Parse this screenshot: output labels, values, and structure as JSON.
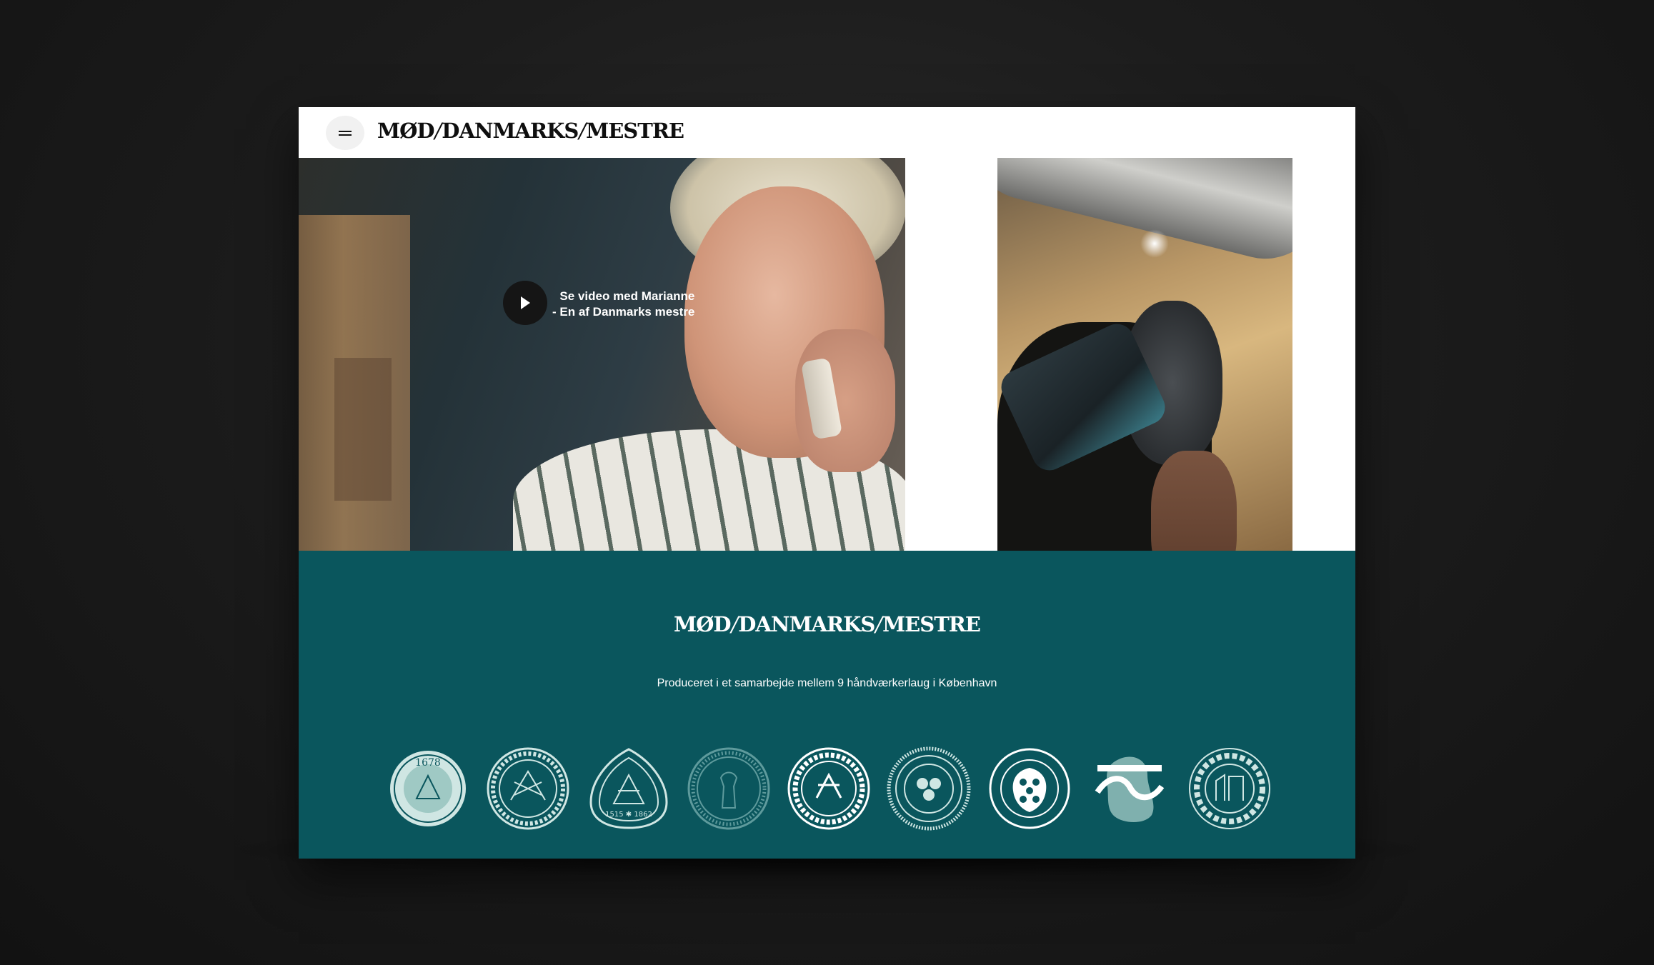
{
  "header": {
    "logo": {
      "word1": "MØD",
      "word2": "DANMARKS",
      "word3": "MESTRE"
    }
  },
  "hero": {
    "caption_line1": "Se video med Marianne",
    "caption_line2": "- En af Danmarks mestre"
  },
  "footer": {
    "logo": {
      "word1": "MØD",
      "word2": "DANMARKS",
      "word3": "MESTRE"
    },
    "description": "Produceret i et samarbejde mellem 9 håndværkerlaug i København",
    "seals": [
      {
        "id": "seal-1678",
        "text": "1678"
      },
      {
        "id": "seal-stukkatorlaug",
        "text": "STUKKATØRLAUG KØBENHAVN"
      },
      {
        "id": "seal-tomrerlaug",
        "text": "Københavns Tømrerlaug 1515 1862"
      },
      {
        "id": "seal-ornate",
        "text": ""
      },
      {
        "id": "seal-snedkernes",
        "text": "KØBENHAVNS SNEDKERNES"
      },
      {
        "id": "seal-malerlaug",
        "text": ""
      },
      {
        "id": "seal-glarmesterlauget",
        "text": "GLARMESTERLAUGET DANMARK"
      },
      {
        "id": "seal-wave",
        "text": ""
      },
      {
        "id": "seal-murerlaug",
        "text": "KØBENHAVNS MURERLAUG"
      }
    ]
  },
  "colors": {
    "footer_bg": "#0a565d",
    "header_bg": "#ffffff",
    "play_button": "#151515",
    "seal_color": "#cfe6e3"
  },
  "icons": {
    "menu": "hamburger-icon",
    "play": "play-icon"
  }
}
